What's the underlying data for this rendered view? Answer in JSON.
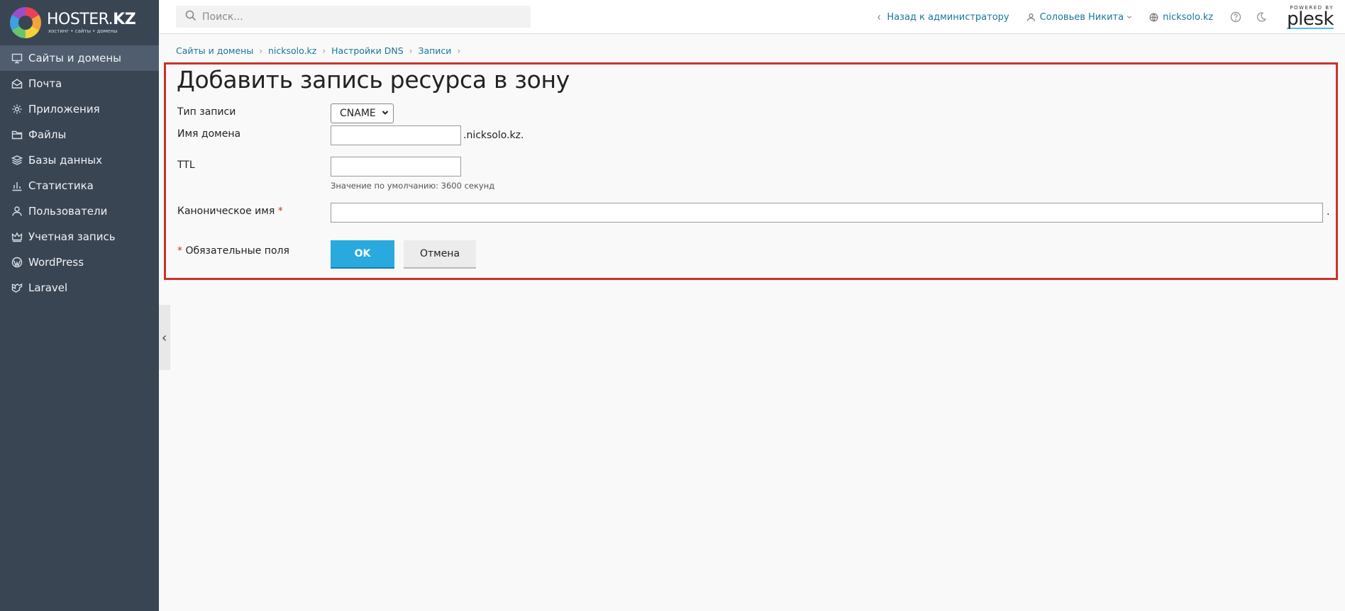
{
  "brand": {
    "name_regular": "HOSTER.",
    "name_bold": "KZ",
    "tagline": "хостинг • сайты • домены"
  },
  "sidebar": {
    "items": [
      {
        "label": "Сайты и домены",
        "icon": "monitor-icon",
        "active": true
      },
      {
        "label": "Почта",
        "icon": "mail-icon"
      },
      {
        "label": "Приложения",
        "icon": "gear-icon"
      },
      {
        "label": "Файлы",
        "icon": "folder-icon"
      },
      {
        "label": "Базы данных",
        "icon": "layers-icon"
      },
      {
        "label": "Статистика",
        "icon": "bar-chart-icon"
      },
      {
        "label": "Пользователи",
        "icon": "user-icon"
      },
      {
        "label": "Учетная запись",
        "icon": "crown-icon"
      },
      {
        "label": "WordPress",
        "icon": "wordpress-icon"
      },
      {
        "label": "Laravel",
        "icon": "laravel-icon"
      }
    ]
  },
  "topbar": {
    "search_placeholder": "Поиск...",
    "back_link": "Назад к администратору",
    "user_name": "Соловьев Никита",
    "domain_link": "nicksolo.kz",
    "powered_by": "POWERED BY",
    "plesk": "plesk"
  },
  "breadcrumb": [
    "Сайты и домены",
    "nicksolo.kz",
    "Настройки DNS",
    "Записи"
  ],
  "form": {
    "title": "Добавить запись ресурса в зону",
    "record_type_label": "Тип записи",
    "record_type_value": "CNAME",
    "domain_label": "Имя домена",
    "domain_value": "",
    "domain_suffix": ".nicksolo.kz.",
    "ttl_label": "TTL",
    "ttl_value": "",
    "ttl_hint": "Значение по умолчанию: 3600 секунд",
    "canonical_label": "Каноническое имя",
    "canonical_value": "",
    "canonical_suffix": ".",
    "required_marker": "*",
    "required_note": "Обязательные поля",
    "ok_label": "OK",
    "cancel_label": "Отмена"
  },
  "colors": {
    "sidebar_bg": "#3a4554",
    "sidebar_active": "#4f5d6e",
    "link": "#17779c",
    "primary_button": "#28aade",
    "highlight_border": "#c9332b"
  }
}
